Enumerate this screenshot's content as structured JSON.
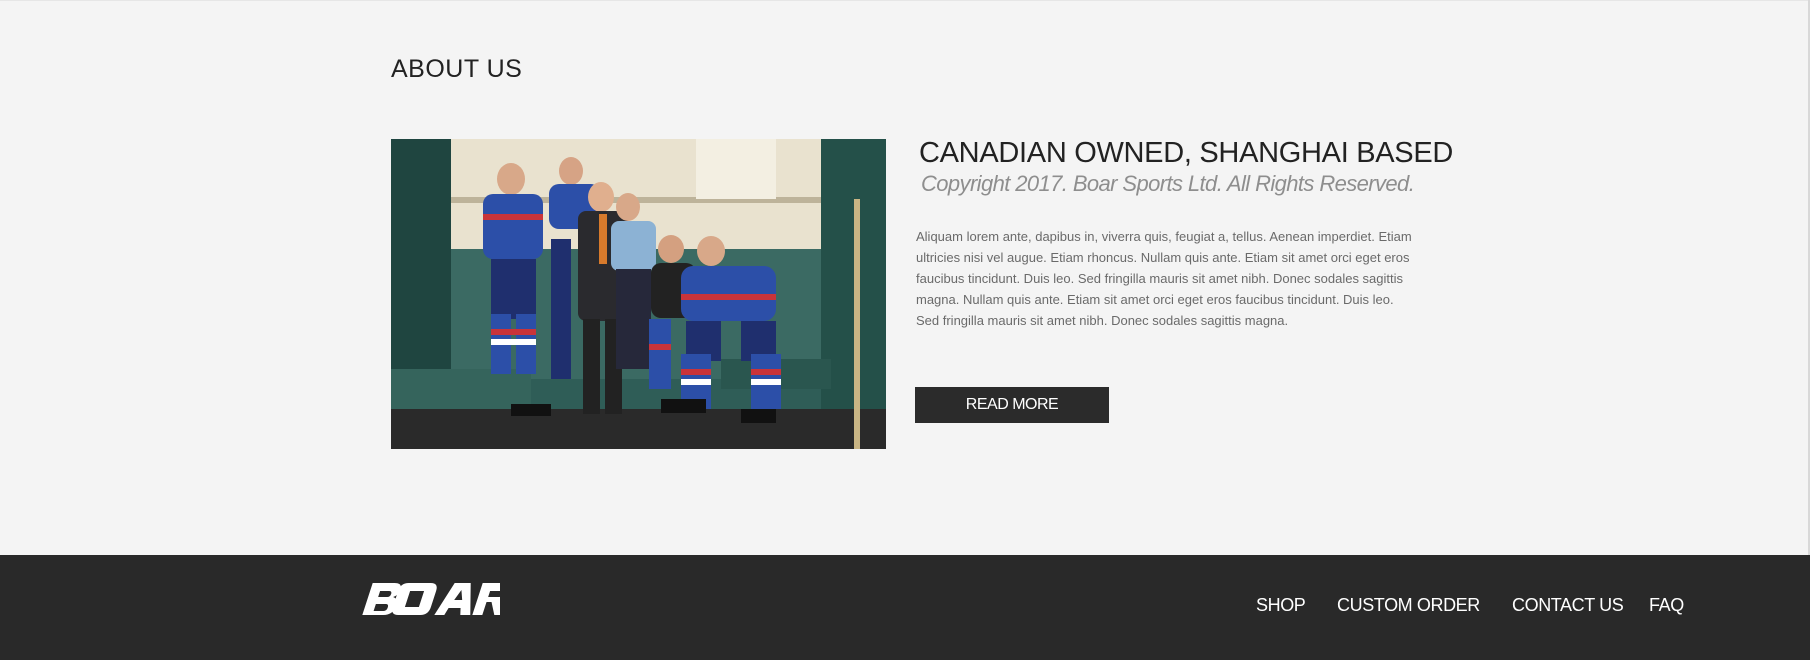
{
  "about": {
    "section_title": "ABOUT US",
    "headline": "CANADIAN OWNED, SHANGHAI BASED",
    "copyright": "Copyright 2017. Boar Sports Ltd. All Rights Reserved.",
    "body": "Aliquam lorem ante, dapibus in, viverra quis, feugiat a, tellus. Aenean imperdiet. Etiam ultricies nisi vel augue. Etiam rhoncus. Nullam quis ante. Etiam sit amet orci eget eros faucibus tincidunt. Duis leo. Sed fringilla mauris sit amet nibh. Donec sodales sagittis magna. Nullam quis ante. Etiam sit amet orci eget eros faucibus tincidunt. Duis leo. Sed fringilla mauris sit amet nibh. Donec sodales sagittis magna.",
    "read_more_label": "READ MORE",
    "photo_subject": "hockey-team-locker-room-photo"
  },
  "footer": {
    "logo_text": "BOAR",
    "nav": [
      {
        "label": "SHOP"
      },
      {
        "label": "CUSTOM ORDER"
      },
      {
        "label": "CONTACT US"
      },
      {
        "label": "FAQ"
      }
    ]
  },
  "colors": {
    "page_bg": "#f4f4f4",
    "footer_bg": "#292929",
    "button_bg": "#2b2b2b",
    "heading": "#222222",
    "muted_text": "#8e8e8e"
  }
}
